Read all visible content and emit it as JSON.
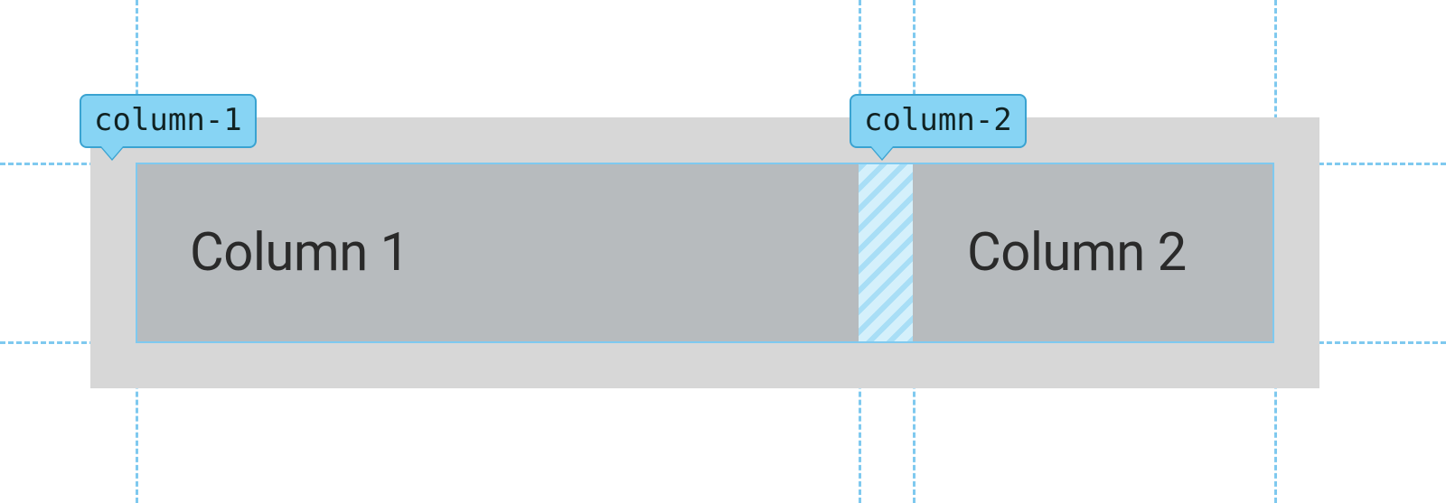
{
  "labels": {
    "col1_tag": "column-1",
    "col2_tag": "column-2"
  },
  "cells": {
    "col1_text": "Column 1",
    "col2_text": "Column 2"
  },
  "colors": {
    "guide": "#7fc9ef",
    "label_bg": "#87d4f4",
    "label_border": "#3aa3d1",
    "container_bg": "#d7d7d7",
    "cell_bg": "#b7bbbe"
  }
}
